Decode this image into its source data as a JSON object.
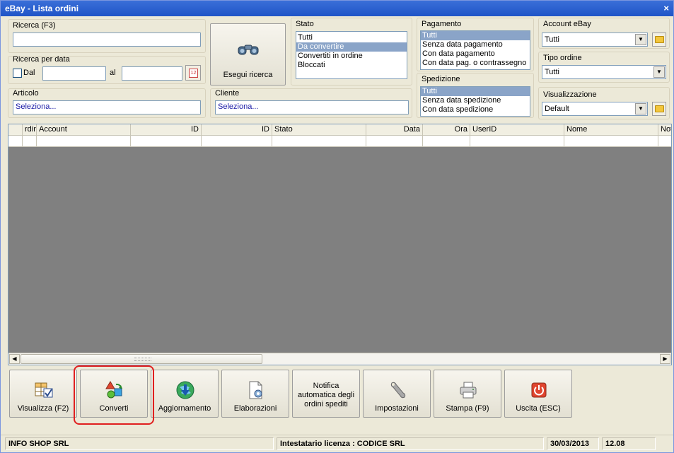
{
  "window": {
    "title": "eBay - Lista ordini",
    "close": "×"
  },
  "search": {
    "label": "Ricerca (F3)",
    "value": "",
    "date_group_label": "Ricerca per data",
    "dal_label": "Dal",
    "al_label": "al",
    "dal_value": "",
    "al_value": "",
    "calendar_text": "12",
    "button_label": "Esegui ricerca"
  },
  "articolo": {
    "label": "Articolo",
    "value": "Seleziona..."
  },
  "cliente": {
    "label": "Cliente",
    "value": "Seleziona..."
  },
  "stato": {
    "label": "Stato",
    "items": [
      "Tutti",
      "Da convertire",
      "Convertiti in ordine",
      "Bloccati"
    ],
    "selected_index": 1
  },
  "pagamento": {
    "label": "Pagamento",
    "items": [
      "Tutti",
      "Senza data pagamento",
      "Con data pagamento",
      "Con data pag. o contrassegno"
    ],
    "selected_index": 0
  },
  "spedizione": {
    "label": "Spedizione",
    "items": [
      "Tutti",
      "Senza data spedizione",
      "Con data spedizione"
    ],
    "selected_index": 0
  },
  "account_ebay": {
    "label": "Account eBay",
    "value": "Tutti"
  },
  "tipo_ordine": {
    "label": "Tipo ordine",
    "value": "Tutti"
  },
  "visualizzazione": {
    "label": "Visualizzazione",
    "value": "Default"
  },
  "grid": {
    "columns": [
      "rdir",
      "Account",
      "ID",
      "ID",
      "Stato",
      "Data",
      "Ora",
      "UserID",
      "Nome",
      "Not"
    ]
  },
  "toolbar": {
    "visualizza": "Visualizza (F2)",
    "converti": "Converti",
    "aggiornamento": "Aggiornamento",
    "elaborazioni": "Elaborazioni",
    "notifica": "Notifica automatica degli ordini spediti",
    "impostazioni": "Impostazioni",
    "stampa": "Stampa (F9)",
    "uscita": "Uscita (ESC)"
  },
  "status": {
    "company": "INFO SHOP SRL",
    "license": "Intestatario licenza : CODICE SRL",
    "date": "30/03/2013",
    "time": "12.08"
  },
  "colors": {
    "title_bar": "#1f54c7",
    "selection": "#8aa4c8",
    "highlight": "#e01f1f"
  }
}
